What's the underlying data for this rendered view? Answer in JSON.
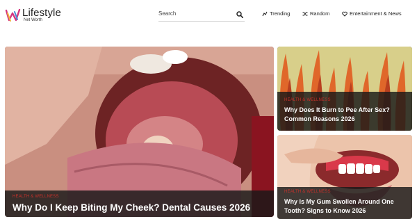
{
  "header": {
    "logo_title": "Lifestyle",
    "logo_tagline": "Net Worth",
    "search": {
      "placeholder": "Search"
    },
    "nav": [
      {
        "label": "Trending",
        "icon": "trending-icon"
      },
      {
        "label": "Random",
        "icon": "shuffle-icon"
      },
      {
        "label": "Entertainment & News",
        "icon": "heart-icon"
      }
    ]
  },
  "articles": [
    {
      "category": "HEALTH & WELLNESS",
      "title": "Why Do I Keep Biting My Cheek? Dental Causes 2026",
      "image": "open-mouth-cheek-photo"
    },
    {
      "category": "HEALTH & WELLNESS",
      "title": "Why Does It Burn to Pee After Sex? Common Reasons 2026",
      "image": "flames-illustration"
    },
    {
      "category": "HEALTH & WELLNESS",
      "title": "Why Is My Gum Swollen Around One Tooth? Signs to Know 2026",
      "image": "swollen-gum-photo"
    }
  ],
  "colors": {
    "accent": "#c8312b",
    "overlay": "#191919",
    "flame": "#e0672a",
    "flame_bg": "#d8cf8a"
  }
}
